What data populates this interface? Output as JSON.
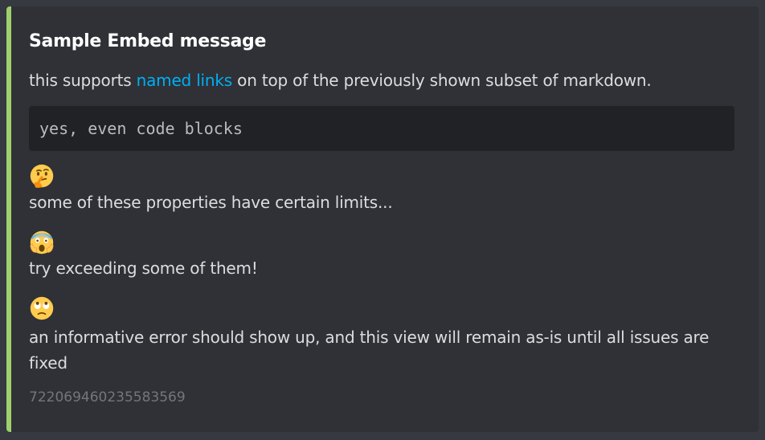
{
  "embed": {
    "accent_color": "#9ed16d",
    "title": "Sample Embed message",
    "description": {
      "prefix": "this supports ",
      "link_text": "named links",
      "suffix": " on top of the previously shown subset of markdown."
    },
    "code_block": "yes, even code blocks",
    "fields": [
      {
        "emoji": "thinking-face-icon",
        "text": "some of these properties have certain limits..."
      },
      {
        "emoji": "screaming-face-icon",
        "text": "try exceeding some of them!"
      },
      {
        "emoji": "eye-roll-face-icon",
        "text": "an informative error should show up, and this view will remain as-is until all issues are fixed"
      }
    ],
    "footer": "722069460235583569"
  },
  "colors": {
    "background": "#36393f",
    "embed_background": "#2f3136",
    "title": "#ffffff",
    "text": "#dcddde",
    "link": "#00aff4",
    "code_background": "#202225",
    "footer": "#72767d"
  }
}
